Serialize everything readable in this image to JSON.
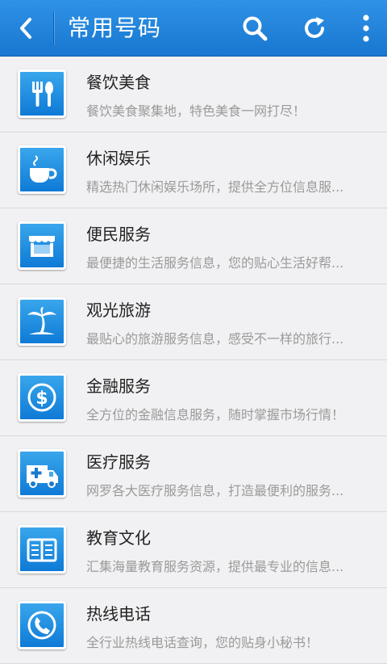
{
  "header": {
    "title": "常用号码",
    "back_icon": "chevron-left-icon",
    "search_icon": "search-icon",
    "refresh_icon": "refresh-icon",
    "more_icon": "more-vertical-icon",
    "bar_color": "#1a7ad2"
  },
  "categories": [
    {
      "name": "餐饮美食",
      "desc": "餐饮美食聚集地，特色美食一网打尽！",
      "icon": "fork-knife-icon"
    },
    {
      "name": "休闲娱乐",
      "desc": "精选热门休闲娱乐场所，提供全方位信息服...",
      "icon": "coffee-cup-icon"
    },
    {
      "name": "便民服务",
      "desc": "最便捷的生活服务信息，您的贴心生活好帮...",
      "icon": "storefront-icon"
    },
    {
      "name": "观光旅游",
      "desc": "最贴心的旅游服务信息，感受不一样的旅行...",
      "icon": "palm-tree-icon"
    },
    {
      "name": "金融服务",
      "desc": "全方位的金融信息服务，随时掌握市场行情！",
      "icon": "dollar-icon"
    },
    {
      "name": "医疗服务",
      "desc": "网罗各大医疗服务信息，打造最便利的服务...",
      "icon": "ambulance-icon"
    },
    {
      "name": "教育文化",
      "desc": "汇集海量教育服务资源，提供最专业的信息...",
      "icon": "open-book-icon"
    },
    {
      "name": "热线电话",
      "desc": "全行业热线电话查询，您的贴身小秘书！",
      "icon": "phone-icon"
    }
  ]
}
